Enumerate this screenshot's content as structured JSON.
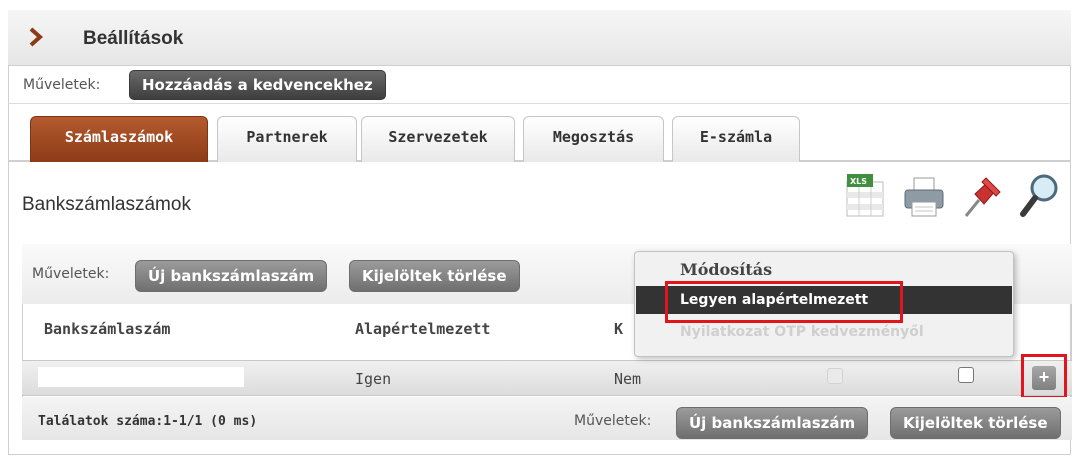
{
  "header": {
    "title": "Beállítások"
  },
  "top_actions": {
    "label": "Műveletek:",
    "favorite_button": "Hozzáadás a kedvencekhez"
  },
  "tabs": [
    {
      "label": "Számlaszámok",
      "active": true
    },
    {
      "label": "Partnerek",
      "active": false
    },
    {
      "label": "Szervezetek",
      "active": false
    },
    {
      "label": "Megosztás",
      "active": false
    },
    {
      "label": "E-számla",
      "active": false
    }
  ],
  "section": {
    "title": "Bankszámlaszámok"
  },
  "toolbar_icons": [
    "xls-export-icon",
    "print-icon",
    "pin-icon",
    "search-icon"
  ],
  "grid": {
    "actions_label": "Műveletek:",
    "new_button": "Új bankszámlaszám",
    "delete_button": "Kijelöltek törlése",
    "columns": [
      "Bankszámlaszám",
      "Alapértelmezett",
      "K"
    ],
    "rows": [
      {
        "account": "",
        "default": "Igen",
        "col3": "Nem",
        "checkbox1_checked": false,
        "checkbox1_disabled": true,
        "checkbox2_checked": false
      }
    ]
  },
  "context_menu": {
    "header": "Módosítás",
    "items": [
      {
        "label": "Legyen alapértelmezett",
        "selected": true,
        "disabled": false
      },
      {
        "label": "Nyilatkozat OTP kedvezményől",
        "selected": false,
        "disabled": true
      }
    ]
  },
  "footer": {
    "count": "Találatok száma:1-1/1 (0 ms)",
    "actions_label": "Műveletek:",
    "new_button": "Új bankszámlaszám",
    "delete_button": "Kijelöltek törlése"
  },
  "colors": {
    "active_tab": "#9a4522",
    "highlight_outline": "#e0161c",
    "menu_selected": "#333333"
  }
}
